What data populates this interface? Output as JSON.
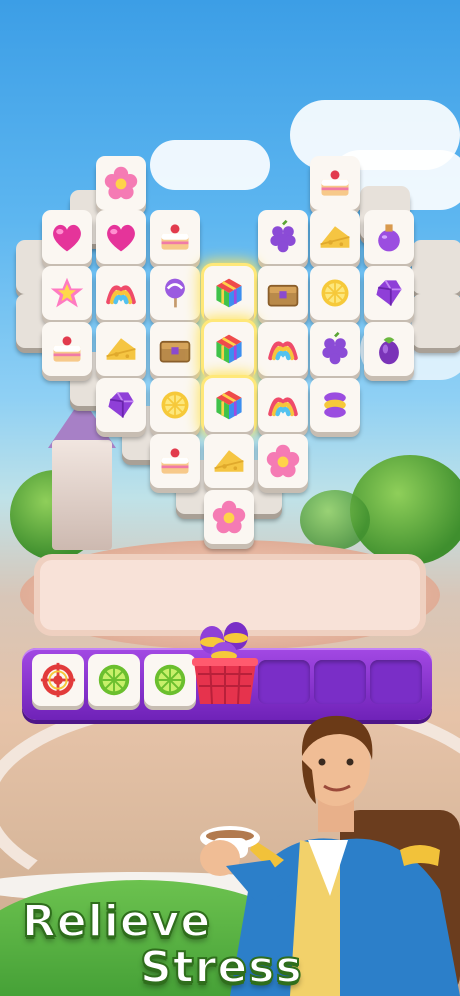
{
  "tagline": {
    "line1": "Relieve",
    "line2": "Stress"
  },
  "board": {
    "highlighted_column": "rainbow-cube",
    "tiles_icon_names": [
      "flower-icon",
      "cake-icon",
      "heart-icon",
      "heart-icon",
      "cake-icon",
      "grapes-icon",
      "cheese-icon",
      "potion-icon",
      "star-icon",
      "rainbow-icon",
      "lollipop-icon",
      "rainbow-cube-icon",
      "chest-icon",
      "lemon-icon",
      "gem-icon",
      "cake-icon",
      "cheese-icon",
      "chest-icon",
      "rainbow-cube-icon",
      "rainbow-icon",
      "grapes-icon",
      "eggplant-icon",
      "gem-icon",
      "lemon-icon",
      "rainbow-cube-icon",
      "rainbow-icon",
      "macaron-icon",
      "cake-icon",
      "cheese-icon",
      "flower-icon",
      "flower-icon"
    ]
  },
  "tray": {
    "slots_total": 7,
    "filled": [
      "target-icon",
      "lime-icon",
      "lime-icon"
    ],
    "basket_icon": "macaron-basket-icon"
  },
  "colors": {
    "tray_purple": "#8a35d4",
    "highlight_glow": "#ffe45a",
    "tagline_fill": "#ffffff",
    "tagline_stroke": "#2f6e1c"
  }
}
